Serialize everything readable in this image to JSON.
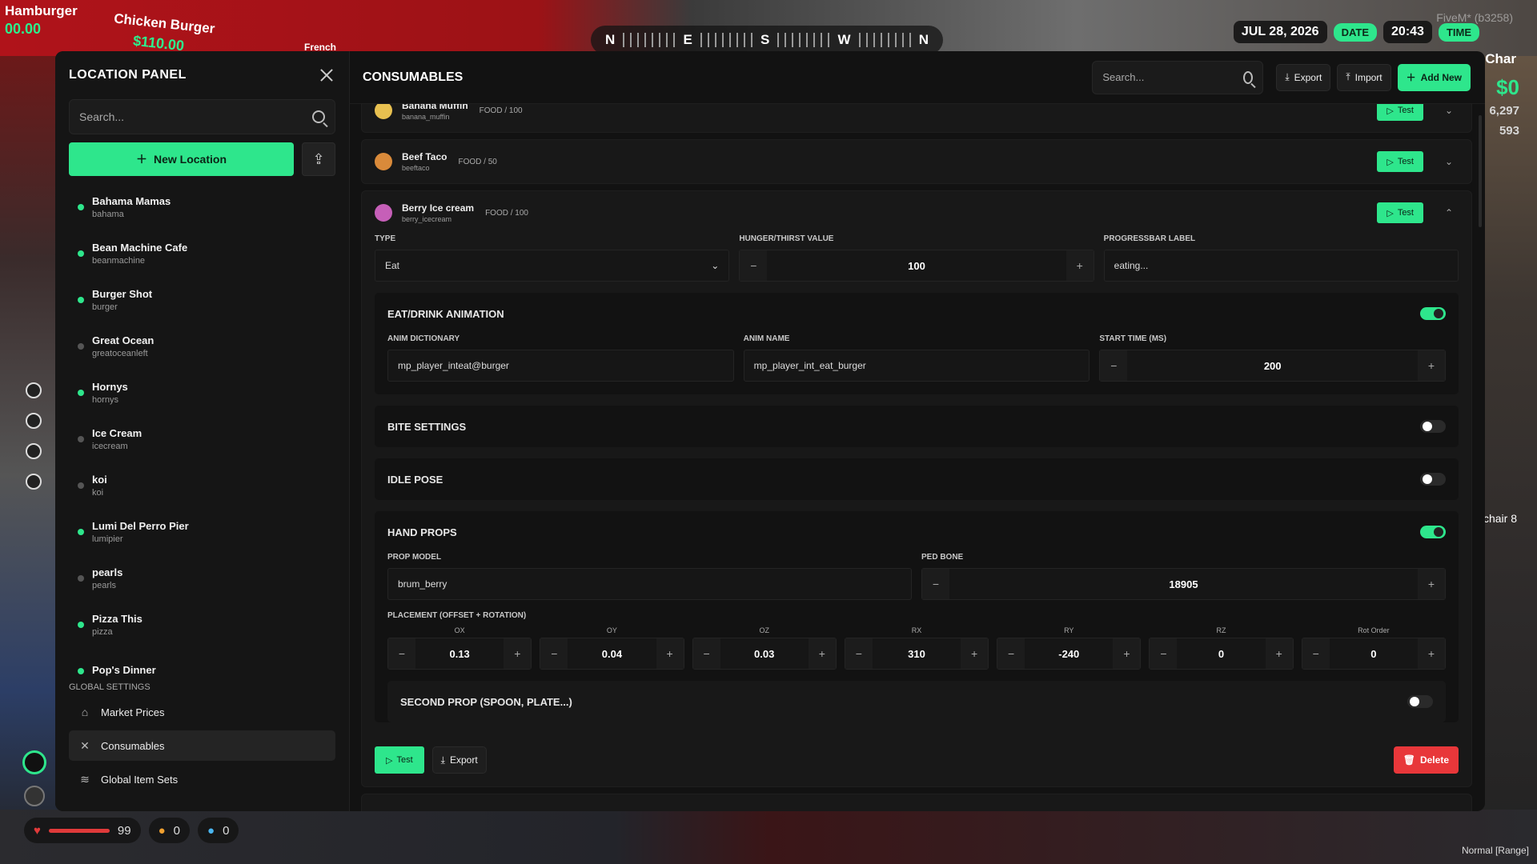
{
  "background": {
    "signs": [
      {
        "text": "Hamburger"
      },
      {
        "text": "Chicken Burger"
      },
      {
        "text": "$110.00"
      },
      {
        "text": "00.00"
      },
      {
        "text": "French"
      }
    ],
    "compass": [
      "N",
      "E",
      "S",
      "W",
      "N"
    ],
    "date": "JUL 28, 2026",
    "date_pill": "DATE",
    "time": "20:43",
    "time_pill": "TIME",
    "fivem": "FiveM* (b3258)",
    "char_label": "Char",
    "money": "$0",
    "bank1": "6,297",
    "bank2": "593",
    "chair_label": "l chair 8",
    "status": "Normal [Range]"
  },
  "hud": {
    "health": "99",
    "hunger": "0",
    "thirst": "0"
  },
  "sidebar": {
    "title": "LOCATION PANEL",
    "search_placeholder": "Search...",
    "new_location": "New Location",
    "locations": [
      {
        "name": "Bahama Mamas",
        "id": "bahama",
        "active": true
      },
      {
        "name": "Bean Machine Cafe",
        "id": "beanmachine",
        "active": true
      },
      {
        "name": "Burger Shot",
        "id": "burger",
        "active": true
      },
      {
        "name": "Great Ocean",
        "id": "greatoceanleft",
        "active": false
      },
      {
        "name": "Hornys",
        "id": "hornys",
        "active": true
      },
      {
        "name": "Ice Cream",
        "id": "icecream",
        "active": false
      },
      {
        "name": "koi",
        "id": "koi",
        "active": false
      },
      {
        "name": "Lumi Del Perro Pier",
        "id": "lumipier",
        "active": true
      },
      {
        "name": "pearls",
        "id": "pearls",
        "active": false
      },
      {
        "name": "Pizza This",
        "id": "pizza",
        "active": true
      },
      {
        "name": "Pop's Dinner",
        "id": "",
        "active": true
      }
    ],
    "global_title": "GLOBAL SETTINGS",
    "global_items": [
      {
        "label": "Market Prices",
        "icon": "store-icon"
      },
      {
        "label": "Consumables",
        "icon": "utensils-icon",
        "active": true
      },
      {
        "label": "Global Item Sets",
        "icon": "layers-icon"
      }
    ]
  },
  "main": {
    "title": "CONSUMABLES",
    "search_placeholder": "Search...",
    "export": "Export",
    "import": "Import",
    "add_new": "Add New",
    "items": [
      {
        "name": "Banana Muffin",
        "id": "banana_muffin",
        "type": "FOOD / 100",
        "test": "Test",
        "color": "#e8c050"
      },
      {
        "name": "Beef Taco",
        "id": "beeftaco",
        "type": "FOOD / 50",
        "test": "Test",
        "color": "#d98a3a"
      },
      {
        "name": "Berry Ice cream",
        "id": "berry_icecream",
        "type": "FOOD / 100",
        "test": "Test",
        "color": "#c65fb8"
      }
    ],
    "editor": {
      "type_label": "TYPE",
      "type_value": "Eat",
      "value_label": "HUNGER/THIRST VALUE",
      "value": "100",
      "progress_label": "PROGRESSBAR LABEL",
      "progress_value": "eating...",
      "anim_title": "EAT/DRINK ANIMATION",
      "anim_dict_label": "ANIM DICTIONARY",
      "anim_dict": "mp_player_inteat@burger",
      "anim_name_label": "ANIM NAME",
      "anim_name": "mp_player_int_eat_burger",
      "start_label": "START TIME (MS)",
      "start": "200",
      "bite_title": "BITE SETTINGS",
      "idle_title": "IDLE POSE",
      "hand_title": "HAND PROPS",
      "prop_model_label": "PROP MODEL",
      "prop_model": "brum_berry",
      "ped_bone_label": "PED BONE",
      "ped_bone": "18905",
      "placement_label": "PLACEMENT (OFFSET + ROTATION)",
      "placement": [
        {
          "label": "OX",
          "value": "0.13"
        },
        {
          "label": "OY",
          "value": "0.04"
        },
        {
          "label": "OZ",
          "value": "0.03"
        },
        {
          "label": "RX",
          "value": "310"
        },
        {
          "label": "RY",
          "value": "-240"
        },
        {
          "label": "RZ",
          "value": "0"
        },
        {
          "label": "Rot Order",
          "value": "0"
        }
      ],
      "second_prop": "SECOND PROP (SPOON, PLATE...)",
      "test": "Test",
      "export": "Export",
      "delete": "Delete"
    },
    "next_item": "Banana Muffin"
  }
}
